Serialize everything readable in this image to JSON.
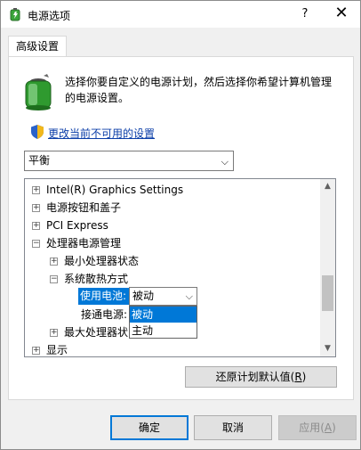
{
  "window": {
    "title": "电源选项",
    "help_label": "?",
    "close_label": "✕"
  },
  "tab": {
    "label": "高级设置"
  },
  "description": "选择你要自定义的电源计划，然后选择你希望计算机管理的电源设置。",
  "change_link": "更改当前不可用的设置",
  "plan_select": {
    "value": "平衡",
    "chevron": "⌵"
  },
  "tree": [
    {
      "label": "Intel(R) Graphics Settings",
      "expander": "+"
    },
    {
      "label": "电源按钮和盖子",
      "expander": "+"
    },
    {
      "label": "PCI Express",
      "expander": "+"
    },
    {
      "label": "处理器电源管理",
      "expander": "−"
    },
    {
      "label": "最小处理器状态",
      "expander": "+"
    },
    {
      "label": "系统散热方式",
      "expander": "−"
    },
    {
      "label": "使用电池:"
    },
    {
      "label": "接通电源:"
    },
    {
      "label": "最大处理器状",
      "expander": "+"
    },
    {
      "label": "显示",
      "expander": "+"
    }
  ],
  "inline_select": {
    "value": "被动",
    "chevron": "⌵"
  },
  "dropdown_options": [
    "被动",
    "主动"
  ],
  "scroll": {
    "up": "▲",
    "down": "▼"
  },
  "restore_button": {
    "label": "还原计划默认值(",
    "mnemonic": "R",
    "suffix": ")"
  },
  "buttons": {
    "ok": "确定",
    "cancel": "取消",
    "apply_label": "应用(",
    "apply_mnemonic": "A",
    "apply_suffix": ")"
  }
}
